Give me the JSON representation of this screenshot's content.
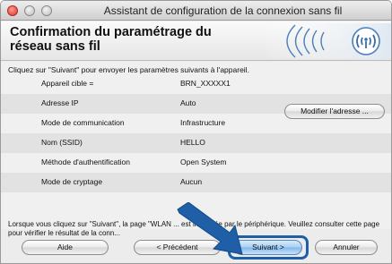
{
  "window": {
    "title": "Assistant de configuration de la connexion sans fil"
  },
  "header": {
    "title": "Confirmation du paramétrage du réseau sans fil"
  },
  "intro_text": "Cliquez sur \"Suivant\" pour envoyer les paramètres suivants à l'appareil.",
  "settings": [
    {
      "label": "Appareil cible =",
      "value": "BRN_XXXXX1"
    },
    {
      "label": "Adresse IP",
      "value": "Auto"
    },
    {
      "label": "Mode de communication",
      "value": "Infrastructure"
    },
    {
      "label": "Nom (SSID)",
      "value": "HELLO"
    },
    {
      "label": "Méthode d'authentification",
      "value": "Open System"
    },
    {
      "label": "Mode de cryptage",
      "value": "Aucun"
    }
  ],
  "modify_button": "Modifier l'adresse ...",
  "bottom_text": "Lorsque vous cliquez sur \"Suivant\", la page \"WLAN ... est imprimée par le périphérique. Veuillez consulter cette page pour vérifier le résultat de la conn...",
  "buttons": {
    "help": "Aide",
    "previous": "< Précédent",
    "next": "Suivant >",
    "cancel": "Annuler"
  },
  "colors": {
    "focus_ring": "#1f5fa8",
    "arrow": "#1f5fa8",
    "wifi_rings": "#4d7fb8"
  },
  "icons": {
    "banner": "wifi-signal-icon",
    "pointer": "arrow-pointer-icon"
  }
}
